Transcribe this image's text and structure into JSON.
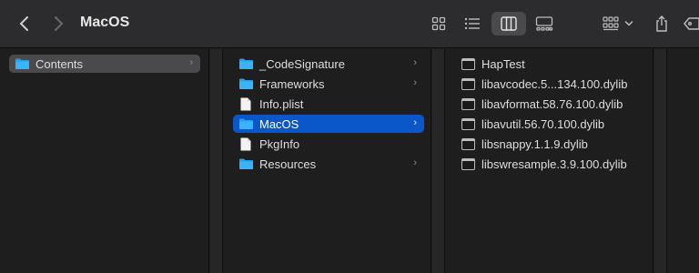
{
  "window": {
    "title": "MacOS"
  },
  "toolbar": {
    "back_icon": "chevron-left-icon",
    "forward_icon": "chevron-right-icon",
    "views": [
      "icon-view-icon",
      "list-view-icon",
      "column-view-icon",
      "gallery-view-icon"
    ],
    "group_icon": "group-by-icon",
    "share_icon": "share-icon",
    "tags_icon": "tag-icon"
  },
  "columns": [
    {
      "items": [
        {
          "label": "Contents",
          "type": "folder",
          "has_children": true,
          "state": "selected-inactive"
        }
      ]
    },
    {
      "items": [
        {
          "label": "_CodeSignature",
          "type": "folder",
          "has_children": true
        },
        {
          "label": "Frameworks",
          "type": "folder",
          "has_children": true
        },
        {
          "label": "Info.plist",
          "type": "file"
        },
        {
          "label": "MacOS",
          "type": "folder",
          "has_children": true,
          "state": "selected-active"
        },
        {
          "label": "PkgInfo",
          "type": "file"
        },
        {
          "label": "Resources",
          "type": "folder",
          "has_children": true
        }
      ]
    },
    {
      "items": [
        {
          "label": "HapTest",
          "type": "exec"
        },
        {
          "label": "libavcodec.5...134.100.dylib",
          "type": "exec"
        },
        {
          "label": "libavformat.58.76.100.dylib",
          "type": "exec"
        },
        {
          "label": "libavutil.56.70.100.dylib",
          "type": "exec"
        },
        {
          "label": "libsnappy.1.1.9.dylib",
          "type": "exec"
        },
        {
          "label": "libswresample.3.9.100.dylib",
          "type": "exec"
        }
      ]
    }
  ],
  "colors": {
    "accent": "#0a57c9",
    "folder": "#1ea1f1"
  }
}
